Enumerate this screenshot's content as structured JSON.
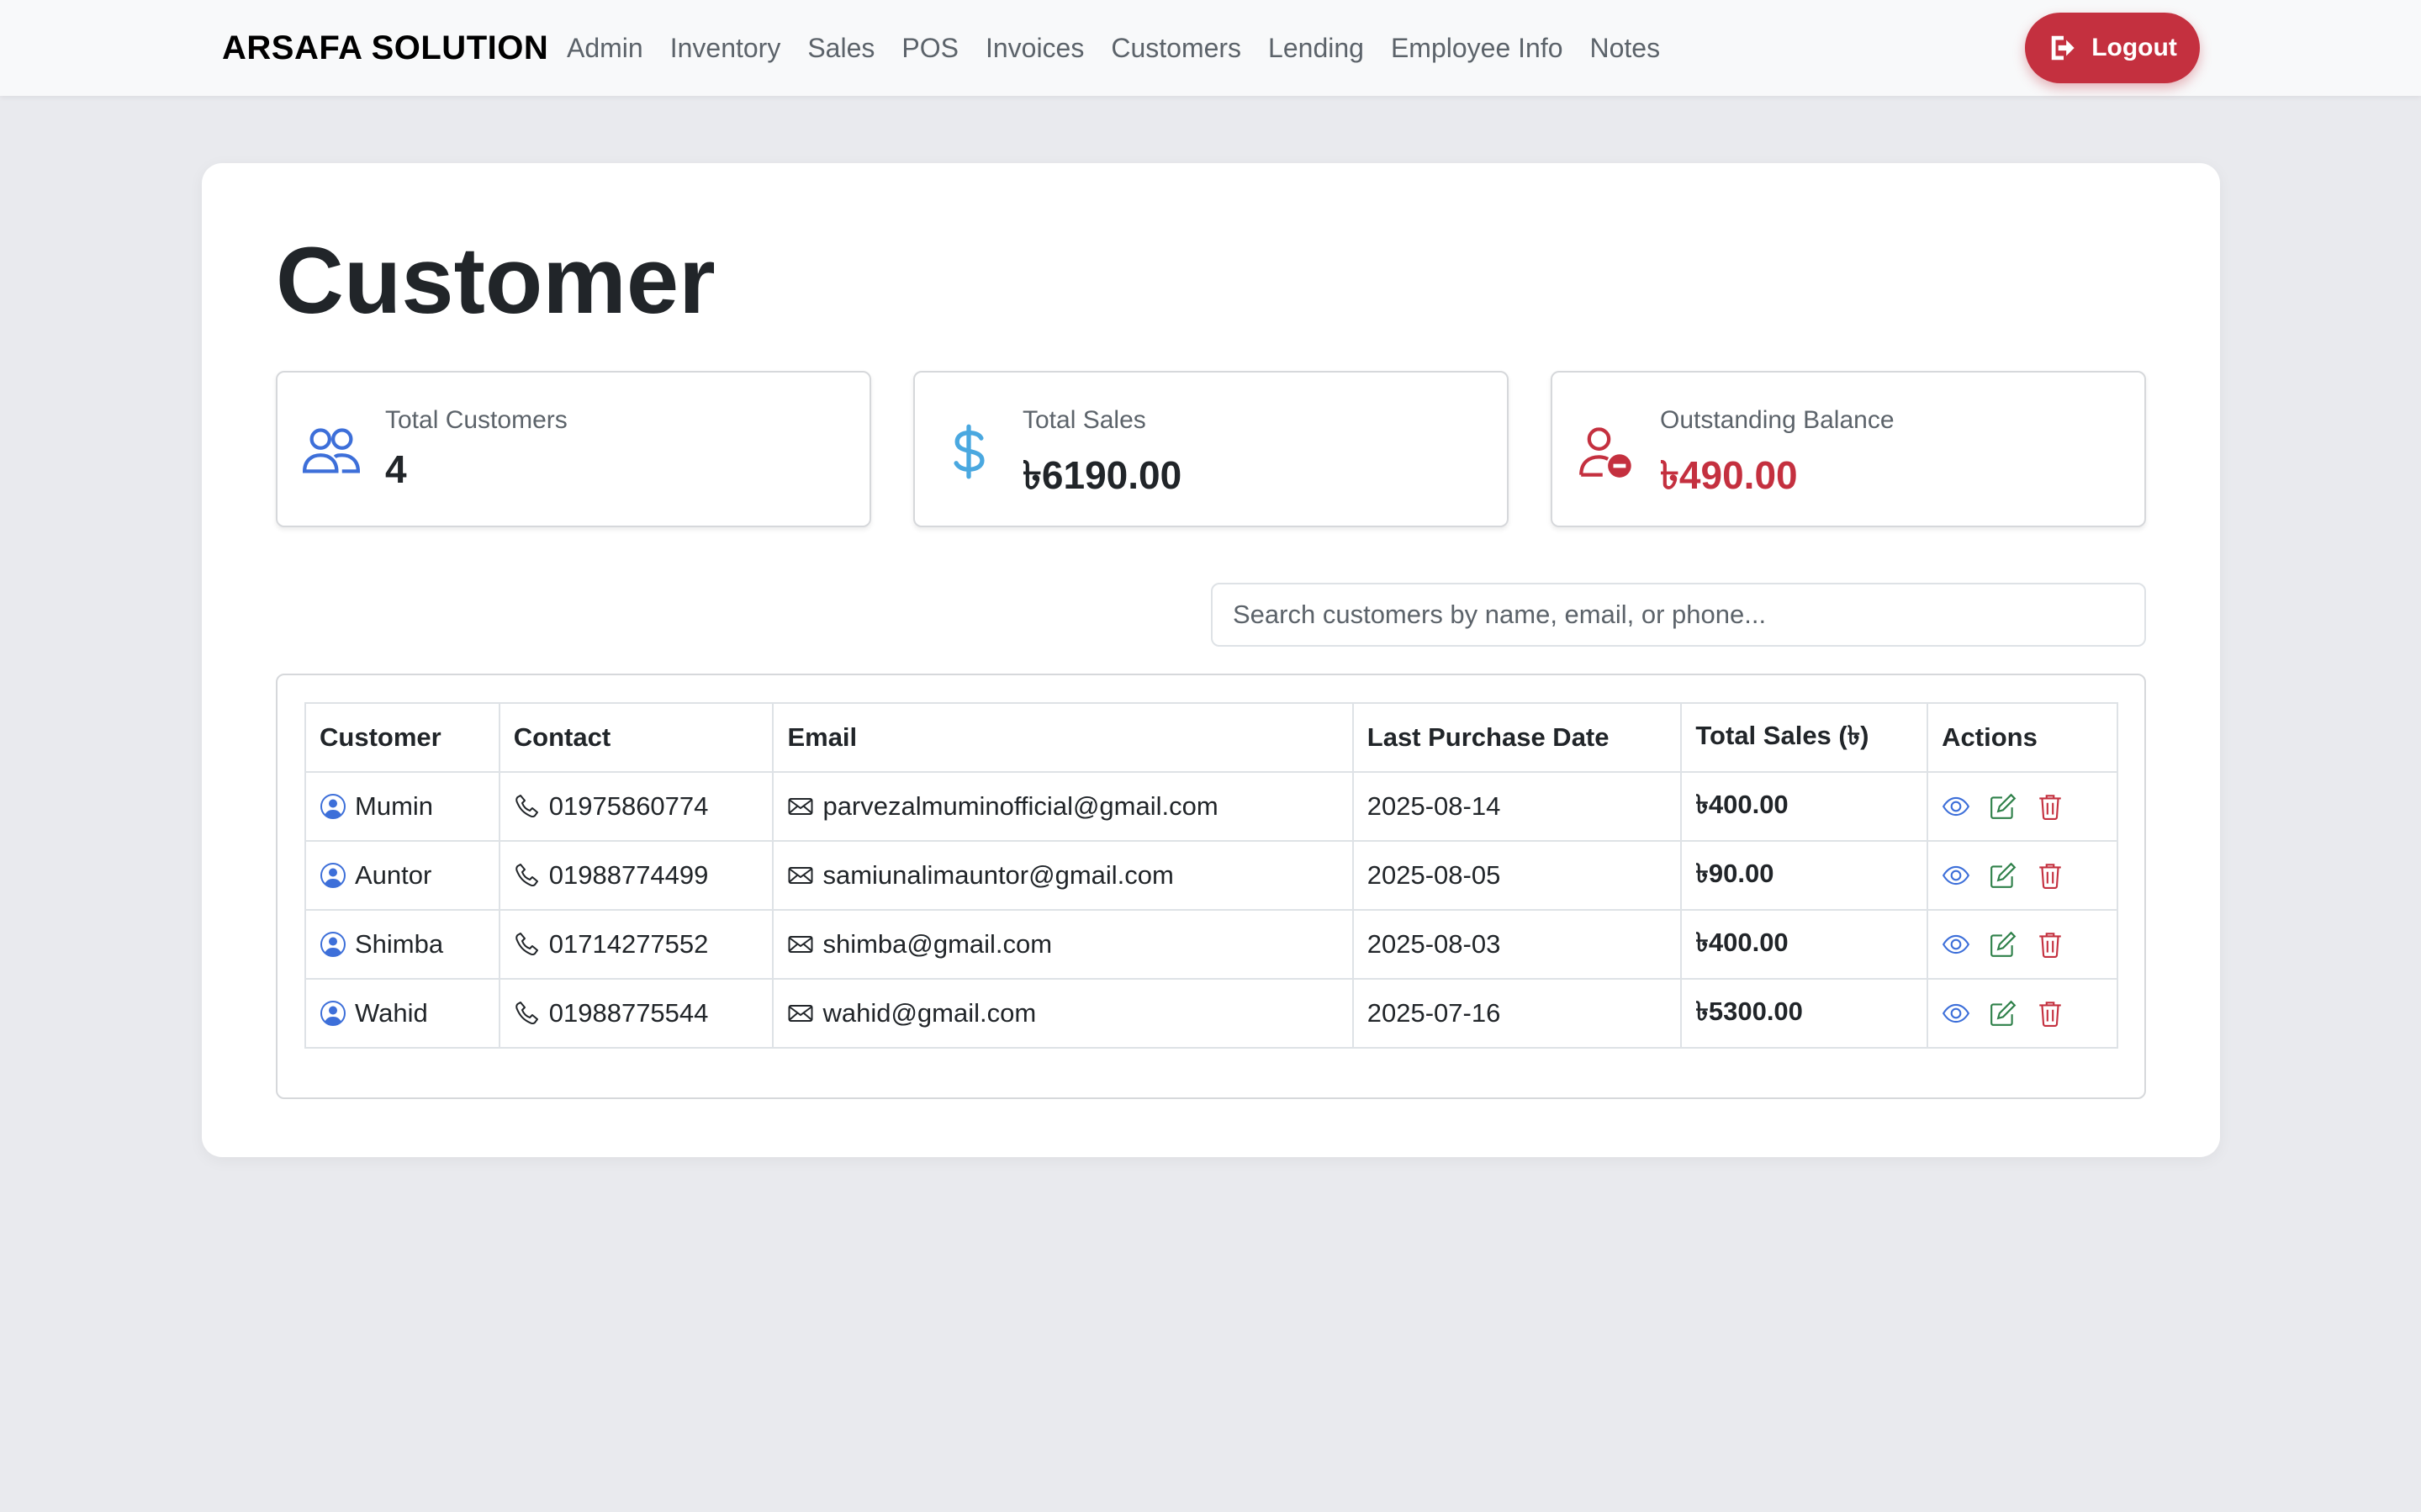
{
  "navbar": {
    "brand": "ARSAFA SOLUTION",
    "links": [
      "Admin",
      "Inventory",
      "Sales",
      "POS",
      "Invoices",
      "Customers",
      "Lending",
      "Employee Info",
      "Notes"
    ],
    "logout_label": "Logout"
  },
  "page": {
    "title": "Customer"
  },
  "stats": {
    "total_customers": {
      "label": "Total Customers",
      "value": "4",
      "icon": "people-icon"
    },
    "total_sales": {
      "label": "Total Sales",
      "value": "৳6190.00",
      "icon": "dollar-icon"
    },
    "outstanding": {
      "label": "Outstanding Balance",
      "value": "৳490.00",
      "icon": "person-remove-icon"
    }
  },
  "search": {
    "placeholder": "Search customers by name, email, or phone...",
    "value": ""
  },
  "table": {
    "headers": [
      "Customer",
      "Contact",
      "Email",
      "Last Purchase Date",
      "Total Sales (৳)",
      "Actions"
    ],
    "rows": [
      {
        "name": "Mumin",
        "contact": "01975860774",
        "email": "parvezalmuminofficial@gmail.com",
        "date": "2025-08-14",
        "sales": "৳400.00"
      },
      {
        "name": "Auntor",
        "contact": "01988774499",
        "email": "samiunalimauntor@gmail.com",
        "date": "2025-08-05",
        "sales": "৳90.00"
      },
      {
        "name": "Shimba",
        "contact": "01714277552",
        "email": "shimba@gmail.com",
        "date": "2025-08-03",
        "sales": "৳400.00"
      },
      {
        "name": "Wahid",
        "contact": "01988775544",
        "email": "wahid@gmail.com",
        "date": "2025-07-16",
        "sales": "৳5300.00"
      }
    ]
  },
  "colors": {
    "primary": "#3d6fd9",
    "info": "#4aa8e0",
    "success": "#2e8049",
    "danger": "#c4303f",
    "background": "#e9eaee"
  }
}
